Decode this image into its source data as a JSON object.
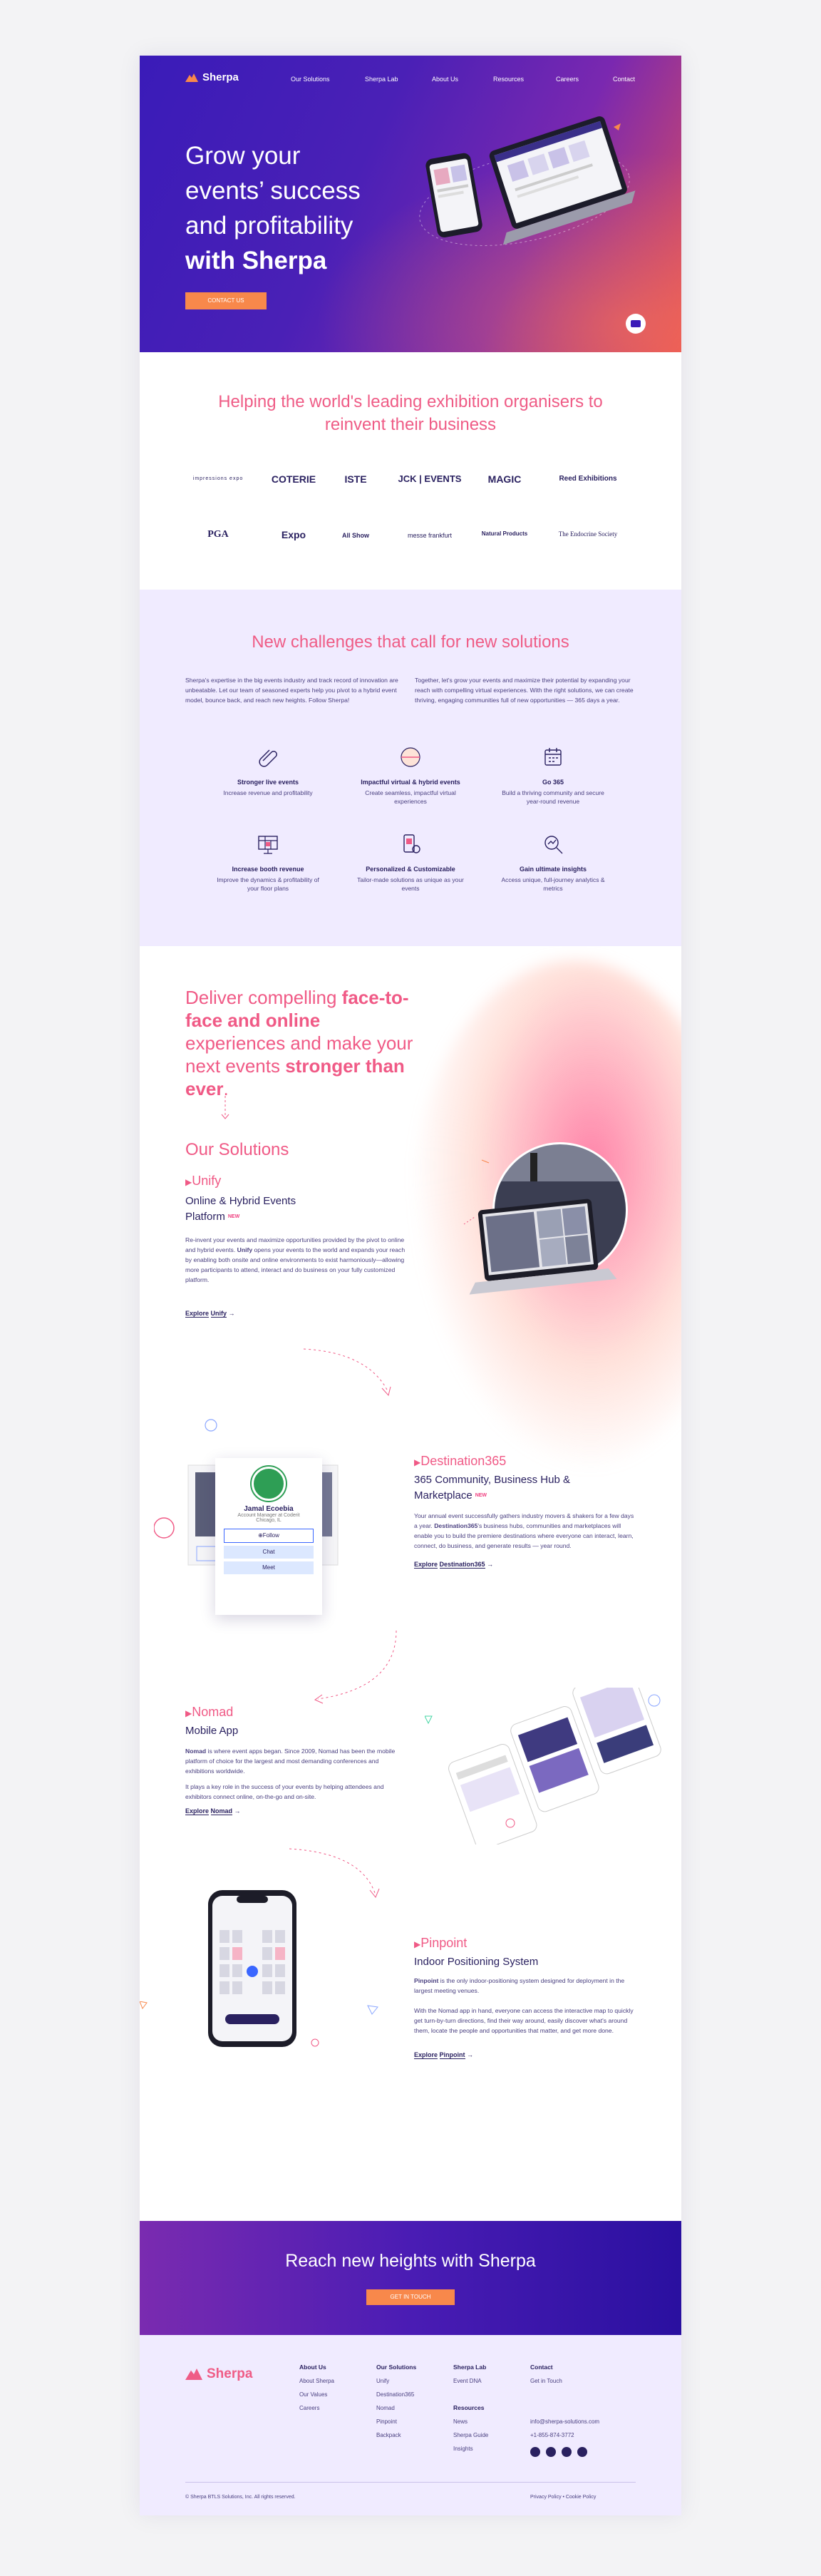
{
  "brand": {
    "name": "Sherpa",
    "pink": "#ef5c86",
    "navy": "#2a2160",
    "orange": "#f8884b",
    "lavender": "#f0ebff",
    "purple": "#4a20b6"
  },
  "nav": {
    "items": [
      "Our Solutions",
      "Sherpa Lab",
      "About Us",
      "Resources",
      "Careers",
      "Contact"
    ]
  },
  "hero": {
    "title_lines": [
      "Grow your",
      "events’ success",
      "and profitability"
    ],
    "title_strong": "with Sherpa",
    "cta": "CONTACT US",
    "chat_icon": "mail-icon"
  },
  "clients": {
    "heading": "Helping the world's leading exhibition organisers to reinvent their business",
    "row1": [
      "impressions expo",
      "COTERIE",
      "ISTE",
      "JCK | EVENTS",
      "MAGIC",
      "Reed Exhibitions"
    ],
    "row2": [
      "PGA",
      "Expo",
      "All Show",
      "messe frankfurt",
      "Natural Products",
      "The Endocrine Society"
    ]
  },
  "challenges": {
    "heading": "New challenges that call for new solutions",
    "para_left": "Sherpa's expertise in the big events industry and track record of innovation are unbeatable. Let our team of seasoned experts help you pivot to a hybrid event model, bounce back, and reach new heights. Follow Sherpa!",
    "para_right": "Together, let's grow your events and maximize their potential by expanding your reach with compelling virtual experiences. With the right solutions, we can create thriving, engaging communities full of new opportunities — 365 days a year.",
    "features": [
      {
        "icon": "clip-icon",
        "title": "Stronger live events",
        "desc": "Increase revenue and profitability"
      },
      {
        "icon": "hybrid-icon",
        "title": "Impactful virtual & hybrid events",
        "desc": "Create seamless, impactful virtual experiences"
      },
      {
        "icon": "calendar-icon",
        "title": "Go 365",
        "desc": "Build a thriving community and secure year-round revenue"
      },
      {
        "icon": "floorplan-icon",
        "title": "Increase booth revenue",
        "desc": "Improve the dynamics & profitability of your floor plans"
      },
      {
        "icon": "personalize-icon",
        "title": "Personalized & Customizable",
        "desc": "Tailor-made solutions as unique as your events"
      },
      {
        "icon": "insight-icon",
        "title": "Gain ultimate insights",
        "desc": "Access unique, full-journey analytics & metrics"
      }
    ]
  },
  "solutions": {
    "intro_a": "Deliver compelling",
    "intro_b": "face-to-face and online",
    "intro_c": "experiences and make your next events",
    "intro_d": "stronger than ever",
    "intro_e": ".",
    "heading": "Our Solutions",
    "new_badge": "NEW",
    "products": [
      {
        "name": "Unify",
        "sub": "Online & Hybrid Events Platform",
        "is_new": true,
        "desc_a": "Re-invent your events and maximize opportunities provided by the pivot to online and hybrid events.",
        "desc_b": "Unify",
        "desc_c": "opens your events to the world and expands your reach by enabling both onsite and online environments to exist harmoniously—allowing more participants to attend, interact and do business on your fully customized platform.",
        "explore": "Explore",
        "explore_link": "Unify"
      },
      {
        "name": "Destination365",
        "sub": "365 Community, Business Hub & Marketplace",
        "is_new": true,
        "desc_a": "Your annual event successfully gathers industry movers & shakers for a few days a year.",
        "desc_b": "Destination365",
        "desc_c": "'s business hubs, communities and marketplaces will enable you to build the premiere destinations where everyone can interact, learn, connect, do business, and generate results — year round.",
        "explore": "Explore",
        "explore_link": "Destination365"
      },
      {
        "name": "Nomad",
        "sub": "Mobile App",
        "is_new": false,
        "desc_a": "",
        "desc_b": "Nomad",
        "desc_c": "is where event apps began. Since 2009, Nomad has been the mobile platform of choice for the largest and most demanding conferences and exhibitions worldwide.",
        "desc_d": "It plays a key role in the success of your events by helping attendees and exhibitors connect online, on-the-go and on-site.",
        "explore": "Explore",
        "explore_link": "Nomad"
      },
      {
        "name": "Pinpoint",
        "sub": "Indoor Positioning System",
        "is_new": false,
        "desc_a": "",
        "desc_b": "Pinpoint",
        "desc_c": "is the only indoor-positioning system designed for deployment in the largest meeting venues.",
        "desc_d": "With the Nomad app in hand, everyone can access the interactive map to quickly get turn-by-turn directions, find their way around, easily discover what's around them, locate the people and opportunities that matter, and get more done.",
        "explore": "Explore",
        "explore_link": "Pinpoint"
      }
    ],
    "profile_card": {
      "name": "Jamal Ecoebia",
      "role": "Account Manager at Coderit",
      "city": "Chicago, IL",
      "follow": "Follow",
      "chat": "Chat",
      "meet": "Meet"
    }
  },
  "cta": {
    "title": "Reach new heights with Sherpa",
    "button": "GET IN TOUCH"
  },
  "footer": {
    "cols": [
      {
        "head": "About Us",
        "items": [
          "About Sherpa",
          "Our Values",
          "Careers"
        ]
      },
      {
        "head": "Our Solutions",
        "items": [
          "Unify",
          "Destination365",
          "Nomad",
          "Pinpoint",
          "Backpack"
        ]
      },
      {
        "head": "Sherpa Lab",
        "items": [
          "Event DNA"
        ]
      },
      {
        "head": "Contact",
        "items": [
          "Get in Touch"
        ]
      }
    ],
    "resources": {
      "head": "Resources",
      "items": [
        "News",
        "Sherpa Guide",
        "Insights"
      ]
    },
    "email": "info@sherpa-solutions.com",
    "phone": "+1-855-874-3772",
    "social": [
      "facebook-icon",
      "instagram-icon",
      "linkedin-icon",
      "twitter-icon"
    ],
    "copyright": "© Sherpa BTLS Solutions, Inc. All rights reserved.",
    "legal": "Privacy Policy  •  Cookie Policy"
  }
}
